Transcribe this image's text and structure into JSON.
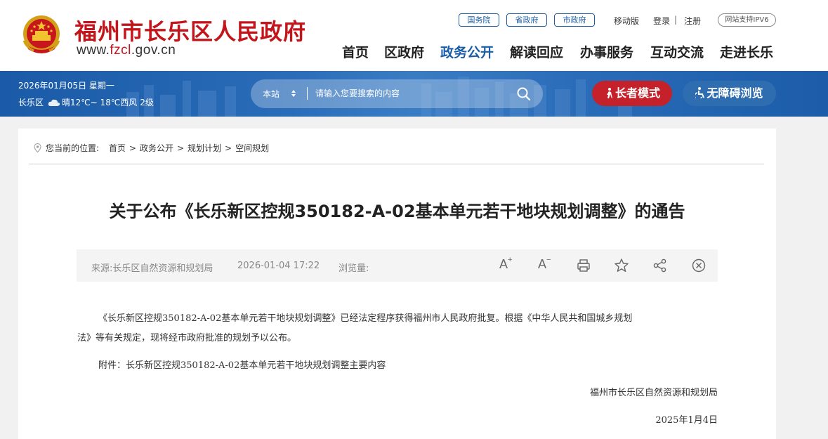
{
  "header": {
    "site_title": "福州市长乐区人民政府",
    "site_url": "www.fzcl.gov.cn",
    "top_pills": [
      "国务院",
      "省政府",
      "市政府"
    ],
    "mobile_label": "移动版",
    "login_label": "登录",
    "register_label": "注册",
    "separator": "|",
    "ipv6_label": "网站支持IPV6",
    "nav": [
      {
        "label": "首页",
        "active": false
      },
      {
        "label": "区政府",
        "active": false
      },
      {
        "label": "政务公开",
        "active": true
      },
      {
        "label": "解读回应",
        "active": false
      },
      {
        "label": "办事服务",
        "active": false
      },
      {
        "label": "互动交流",
        "active": false
      },
      {
        "label": "走进长乐",
        "active": false
      }
    ]
  },
  "band": {
    "date": "2026年01月05日 星期一",
    "district": "长乐区",
    "weather": "晴12℃~ 18℃西风 2级",
    "search_scope": "本站",
    "search_placeholder": "请输入您要搜索的内容",
    "elder_mode_label": "长者模式",
    "accessibility_label": "无障碍浏览"
  },
  "breadcrumb": {
    "prefix": "您当前的位置:",
    "items": [
      "首页",
      "政务公开",
      "规划计划",
      "空间规划"
    ],
    "sep": ">"
  },
  "article": {
    "title": "关于公布《长乐新区控规350182-A-02基本单元若干地块规划调整》的通告",
    "source": "来源:长乐区自然资源和规划局",
    "date": "2026-01-04 17:22",
    "views_label": "浏览量:",
    "tools": {
      "font_up": "A",
      "font_up_sign": "+",
      "font_down": "A",
      "font_down_sign": "−"
    },
    "para1_line1": "《长乐新区控规350182-A-02基本单元若干地块规划调整》已经法定程序获得福州市人民政府批复。根据《中华人民共和国城乡规划",
    "para1_line2": "法》等有关规定，现将经市政府批准的规划予以公布。",
    "attachment": "附件：长乐新区控规350182-A-02基本单元若干地块规划调整主要内容",
    "signature": "福州市长乐区自然资源和规划局",
    "sign_date": "2025年1月4日"
  },
  "colors": {
    "brand_red": "#c3161c",
    "nav_blue": "#1b5ea8",
    "elder_red": "#c5212b",
    "band_blue": "#2a6cb8"
  }
}
